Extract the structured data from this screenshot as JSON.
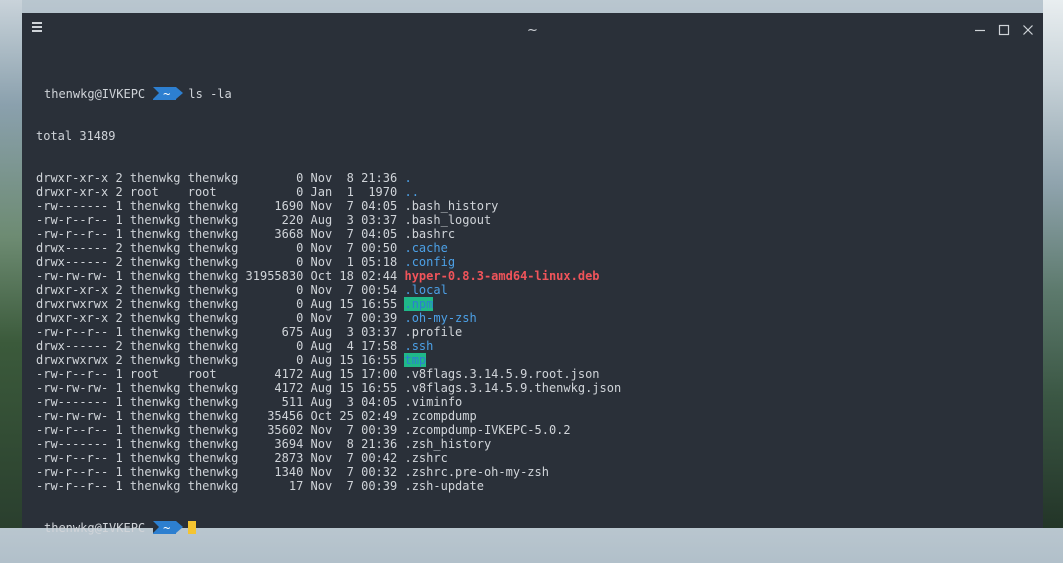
{
  "window": {
    "title": "~"
  },
  "terminal": {
    "prompt": {
      "user_host": "thenwkg@IVKEPC",
      "cwd": "~"
    },
    "command": "ls -la",
    "total": "total 31489",
    "entries": [
      {
        "meta": "drwxr-xr-x 2 thenwkg thenwkg        0 Nov  8 21:36 ",
        "name": ".",
        "type": "dir"
      },
      {
        "meta": "drwxr-xr-x 2 root    root           0 Jan  1  1970 ",
        "name": "..",
        "type": "dir"
      },
      {
        "meta": "-rw------- 1 thenwkg thenwkg     1690 Nov  7 04:05 ",
        "name": ".bash_history",
        "type": "file"
      },
      {
        "meta": "-rw-r--r-- 1 thenwkg thenwkg      220 Aug  3 03:37 ",
        "name": ".bash_logout",
        "type": "file"
      },
      {
        "meta": "-rw-r--r-- 1 thenwkg thenwkg     3668 Nov  7 04:05 ",
        "name": ".bashrc",
        "type": "file"
      },
      {
        "meta": "drwx------ 2 thenwkg thenwkg        0 Nov  7 00:50 ",
        "name": ".cache",
        "type": "dir"
      },
      {
        "meta": "drwx------ 2 thenwkg thenwkg        0 Nov  1 05:18 ",
        "name": ".config",
        "type": "dir"
      },
      {
        "meta": "-rw-rw-rw- 1 thenwkg thenwkg 31955830 Oct 18 02:44 ",
        "name": "hyper-0.8.3-amd64-linux.deb",
        "type": "deb"
      },
      {
        "meta": "drwxr-xr-x 2 thenwkg thenwkg        0 Nov  7 00:54 ",
        "name": ".local",
        "type": "dir"
      },
      {
        "meta": "drwxrwxrwx 2 thenwkg thenwkg        0 Aug 15 16:55 ",
        "name": ".npm",
        "type": "hl"
      },
      {
        "meta": "drwxr-xr-x 2 thenwkg thenwkg        0 Nov  7 00:39 ",
        "name": ".oh-my-zsh",
        "type": "dir"
      },
      {
        "meta": "-rw-r--r-- 1 thenwkg thenwkg      675 Aug  3 03:37 ",
        "name": ".profile",
        "type": "file"
      },
      {
        "meta": "drwx------ 2 thenwkg thenwkg        0 Aug  4 17:58 ",
        "name": ".ssh",
        "type": "dir"
      },
      {
        "meta": "drwxrwxrwx 2 thenwkg thenwkg        0 Aug 15 16:55 ",
        "name": "tmp",
        "type": "hl"
      },
      {
        "meta": "-rw-r--r-- 1 root    root        4172 Aug 15 17:00 ",
        "name": ".v8flags.3.14.5.9.root.json",
        "type": "file"
      },
      {
        "meta": "-rw-rw-rw- 1 thenwkg thenwkg     4172 Aug 15 16:55 ",
        "name": ".v8flags.3.14.5.9.thenwkg.json",
        "type": "file"
      },
      {
        "meta": "-rw------- 1 thenwkg thenwkg      511 Aug  3 04:05 ",
        "name": ".viminfo",
        "type": "file"
      },
      {
        "meta": "-rw-rw-rw- 1 thenwkg thenwkg    35456 Oct 25 02:49 ",
        "name": ".zcompdump",
        "type": "file"
      },
      {
        "meta": "-rw-r--r-- 1 thenwkg thenwkg    35602 Nov  7 00:39 ",
        "name": ".zcompdump-IVKEPC-5.0.2",
        "type": "file"
      },
      {
        "meta": "-rw------- 1 thenwkg thenwkg     3694 Nov  8 21:36 ",
        "name": ".zsh_history",
        "type": "file"
      },
      {
        "meta": "-rw-r--r-- 1 thenwkg thenwkg     2873 Nov  7 00:42 ",
        "name": ".zshrc",
        "type": "file"
      },
      {
        "meta": "-rw-r--r-- 1 thenwkg thenwkg     1340 Nov  7 00:32 ",
        "name": ".zshrc.pre-oh-my-zsh",
        "type": "file"
      },
      {
        "meta": "-rw-r--r-- 1 thenwkg thenwkg       17 Nov  7 00:39 ",
        "name": ".zsh-update",
        "type": "file"
      }
    ]
  },
  "colors": {
    "background": "#2a3039",
    "text": "#d0d4d9",
    "directory": "#4ca0e6",
    "deb_package": "#f0545a",
    "highlight_bg": "#1fb889",
    "prompt_segment": "#2d7fd0",
    "cursor": "#f4c431"
  },
  "icons": {
    "menu": "hamburger-icon",
    "minimize": "minimize-icon",
    "maximize": "maximize-icon",
    "close": "close-icon"
  }
}
